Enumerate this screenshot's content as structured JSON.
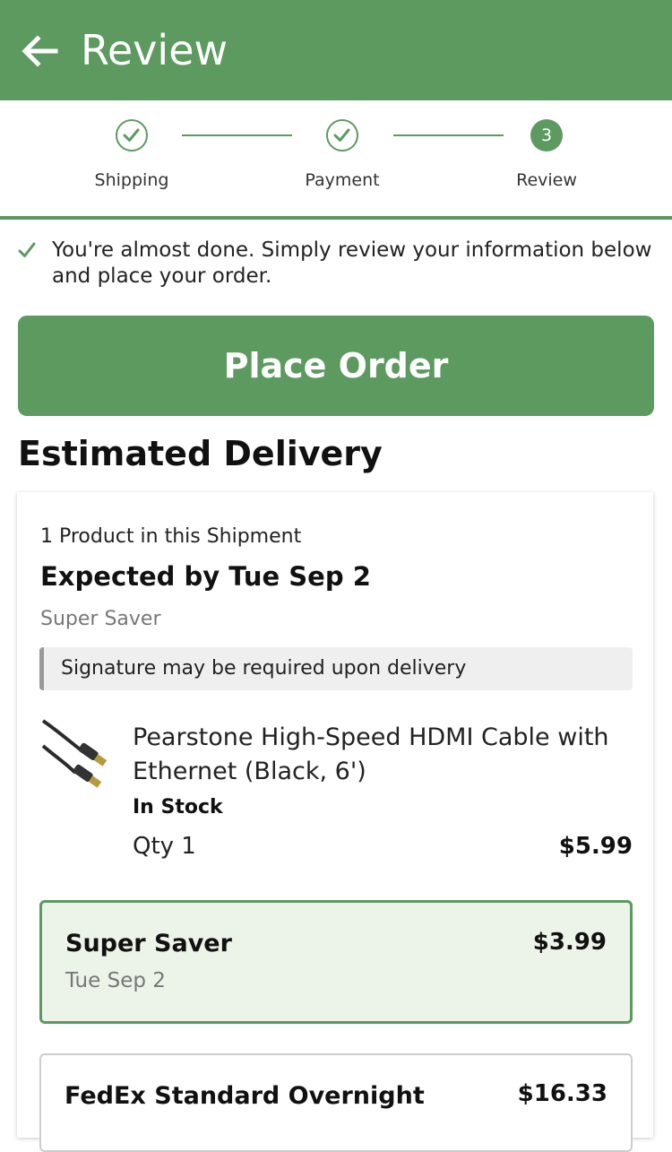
{
  "header": {
    "title": "Review"
  },
  "steps": [
    {
      "label": "Shipping",
      "state": "done"
    },
    {
      "label": "Payment",
      "state": "done"
    },
    {
      "label": "Review",
      "state": "current",
      "number": "3"
    }
  ],
  "notice": "You're almost done. Simply review your information below and place your order.",
  "place_order_label": "Place Order",
  "section_title": "Estimated Delivery",
  "shipment": {
    "count_text": "1 Product in this Shipment",
    "expected": "Expected by Tue Sep 2",
    "method": "Super Saver",
    "signature_note": "Signature may be required upon delivery",
    "product": {
      "name": "Pearstone High-Speed HDMI Cable with Ethernet (Black, 6')",
      "stock": "In Stock",
      "qty": "Qty 1",
      "price": "$5.99"
    },
    "options": [
      {
        "name": "Super Saver",
        "date": "Tue Sep 2",
        "price": "$3.99",
        "selected": true
      },
      {
        "name": "FedEx Standard Overnight",
        "price": "$16.33",
        "selected": false
      }
    ]
  },
  "colors": {
    "brand": "#5c9a60",
    "selected_bg": "#ecf4ea"
  },
  "icons": {
    "back": "arrow-left-icon",
    "check": "check-icon"
  }
}
